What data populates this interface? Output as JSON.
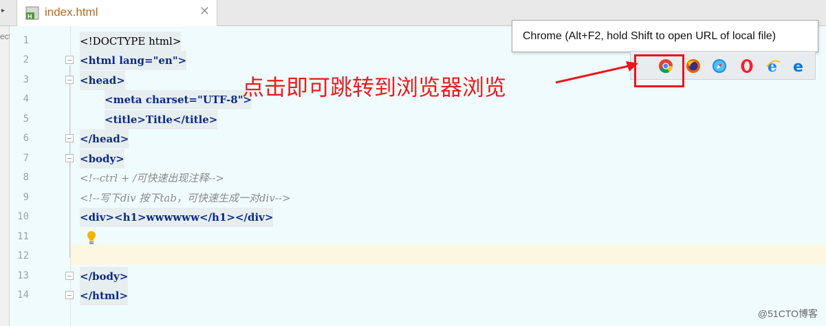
{
  "tab": {
    "title": "index.html",
    "close": "✕",
    "icon_letter": "H"
  },
  "side_label": "ect",
  "code_lines": [
    {
      "n": "1",
      "text": "<!DOCTYPE html>"
    },
    {
      "n": "2",
      "text": "<html lang=\"en\">"
    },
    {
      "n": "3",
      "text": "<head>"
    },
    {
      "n": "4",
      "text": "<meta charset=\"UTF-8\">"
    },
    {
      "n": "5",
      "text": "<title>Title</title>"
    },
    {
      "n": "6",
      "text": "</head>"
    },
    {
      "n": "7",
      "text": "<body>"
    },
    {
      "n": "8",
      "text": "<!--ctrl + /可快速出现注释-->"
    },
    {
      "n": "9",
      "text": "<!--写下div 按下tab，可快速生成一对div-->"
    },
    {
      "n": "10",
      "text": "<div><h1>wwwwww</h1></div>"
    },
    {
      "n": "11",
      "text": ""
    },
    {
      "n": "12",
      "text": ""
    },
    {
      "n": "13",
      "text": "</body>"
    },
    {
      "n": "14",
      "text": "</html>"
    }
  ],
  "tooltip": {
    "text": "Chrome (Alt+F2, hold Shift to open URL of local file)"
  },
  "browsers": [
    {
      "name": "Chrome",
      "icon": "chrome-icon"
    },
    {
      "name": "Firefox",
      "icon": "firefox-icon"
    },
    {
      "name": "Safari",
      "icon": "safari-icon"
    },
    {
      "name": "Opera",
      "icon": "opera-icon"
    },
    {
      "name": "Internet Explorer",
      "icon": "ie-icon"
    },
    {
      "name": "Edge",
      "icon": "edge-icon"
    }
  ],
  "annotation": "点击即可跳转到浏览器浏览",
  "watermark": "@51CTO博客",
  "colors": {
    "annotation": "#ea1c1c",
    "tab_title": "#b86a1f",
    "tag": "#0a2a86",
    "string": "#1b7a1b",
    "comment": "#8a8a8a"
  }
}
